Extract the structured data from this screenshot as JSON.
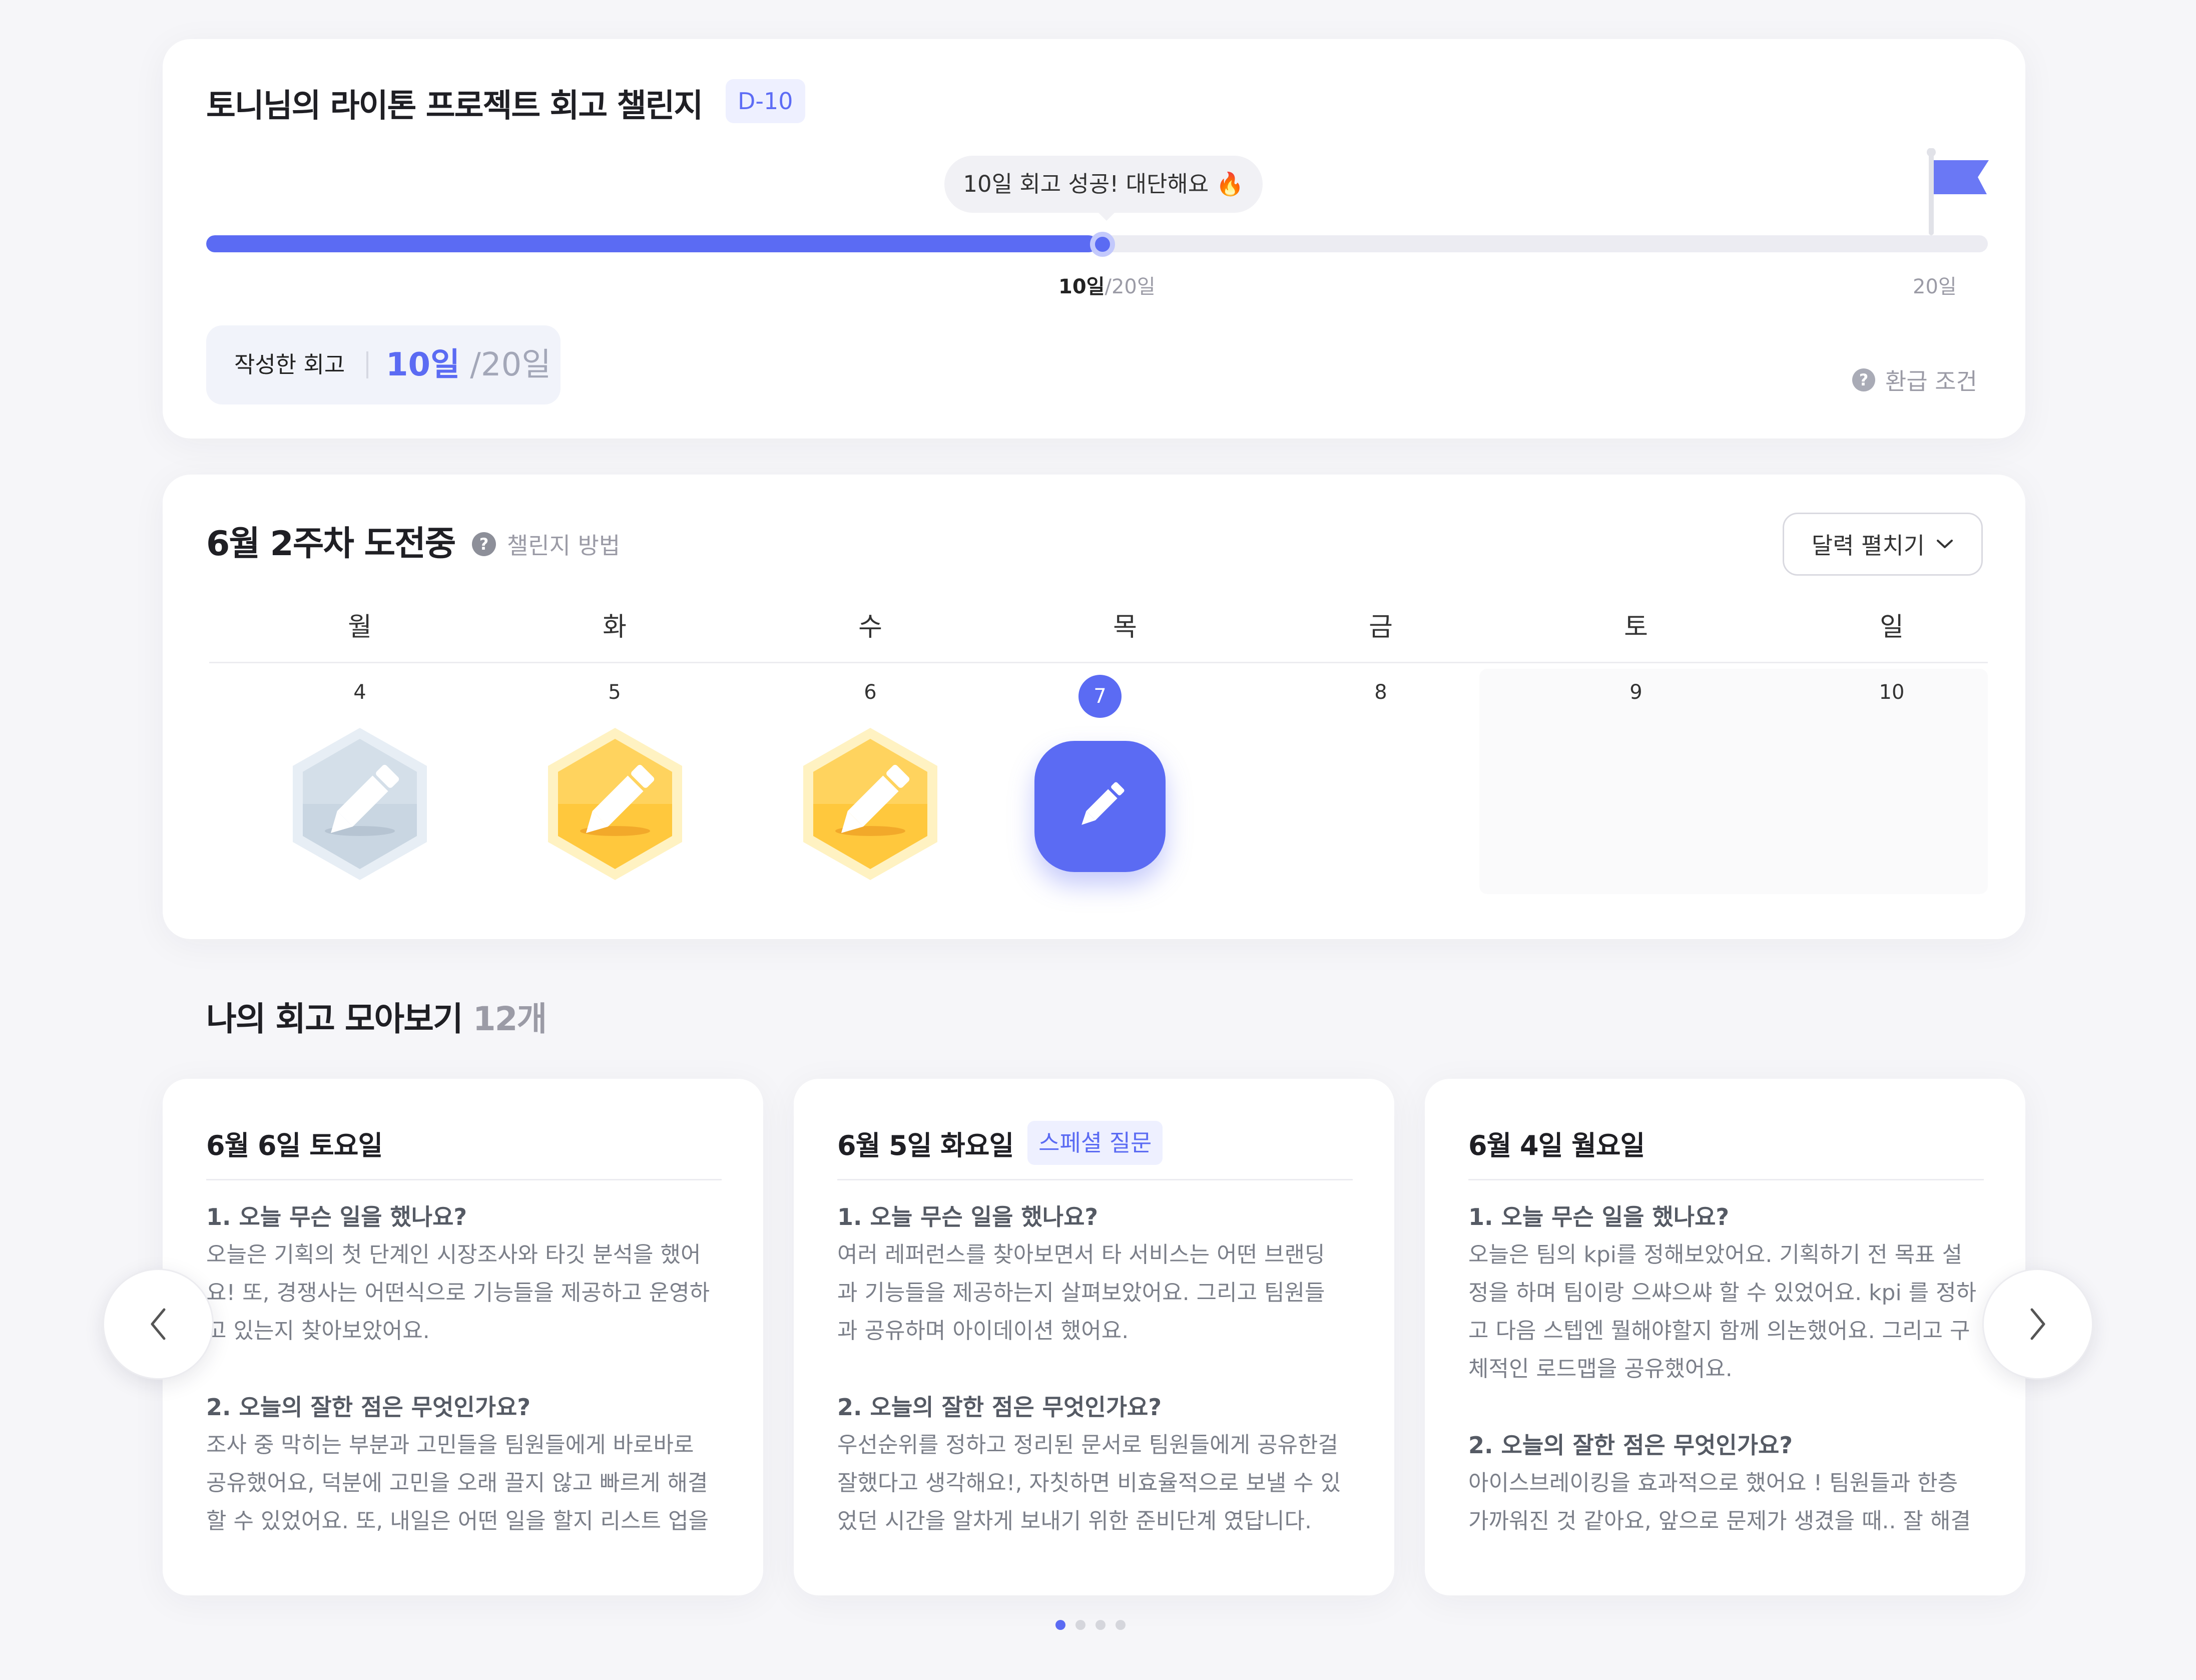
{
  "challenge": {
    "title": "토니님의 라이톤 프로젝트 회고 챌린지",
    "dday": "D-10",
    "bubble": "10일 회고 성공! 대단해요 🔥",
    "progress_fraction": 0.5,
    "progress_current": "10일",
    "progress_total": "/20일",
    "progress_end": "20일",
    "written_label": "작성한 회고",
    "written_current": "10일",
    "written_total": " /20일",
    "refund_label": "환급 조건",
    "accent_color": "#5b6bf3"
  },
  "week": {
    "title": "6월 2주차 도전중",
    "howto_label": "챌린지 방법",
    "calendar_button": "달력 펼치기",
    "days": [
      {
        "weekday": "월",
        "date": "4",
        "status": "silver"
      },
      {
        "weekday": "화",
        "date": "5",
        "status": "gold"
      },
      {
        "weekday": "수",
        "date": "6",
        "status": "gold"
      },
      {
        "weekday": "목",
        "date": "7",
        "status": "today"
      },
      {
        "weekday": "금",
        "date": "8",
        "status": "none"
      },
      {
        "weekday": "토",
        "date": "9",
        "status": "weekend"
      },
      {
        "weekday": "일",
        "date": "10",
        "status": "weekend"
      }
    ]
  },
  "retros": {
    "title": "나의 회고 모아보기",
    "count": "12개",
    "cards": [
      {
        "date": "6월 6일 토요일",
        "badge": "",
        "q1": "1. 오늘 무슨 일을 했나요?",
        "a1": [
          "오늘은 기획의 첫 단계인 시장조사와 타깃 분석을 했어",
          "요! 또, 경쟁사는 어떤식으로 기능들을 제공하고 운영하",
          "고 있는지 찾아보았어요."
        ],
        "q2": "2. 오늘의 잘한 점은 무엇인가요?",
        "a2": [
          "조사 중 막히는 부분과 고민들을 팀원들에게 바로바로",
          "공유했어요, 덕분에 고민을 오래 끌지 않고 빠르게 해결",
          "할 수 있었어요. 또, 내일은 어떤 일을 할지 리스트 업을"
        ]
      },
      {
        "date": "6월 5일 화요일",
        "badge": "스페셜 질문",
        "q1": "1. 오늘 무슨 일을 했나요?",
        "a1": [
          "여러 레퍼런스를 찾아보면서 타 서비스는 어떤 브랜딩",
          "과 기능들을 제공하는지 살펴보았어요. 그리고 팀원들",
          "과 공유하며 아이데이션 했어요."
        ],
        "q2": "2. 오늘의 잘한 점은 무엇인가요?",
        "a2": [
          "우선순위를 정하고 정리된 문서로 팀원들에게 공유한걸",
          "잘했다고 생각해요!, 자칫하면 비효율적으로 보낼 수 있",
          "었던 시간을 알차게 보내기 위한 준비단계 였답니다."
        ]
      },
      {
        "date": "6월 4일 월요일",
        "badge": "",
        "q1": "1. 오늘 무슨 일을 했나요?",
        "a1": [
          "오늘은 팀의 kpi를 정해보았어요. 기획하기 전 목표 설",
          "정을 하며 팀이랑 으쌰으쌰 할 수 있었어요. kpi 를 정하",
          "고 다음 스텝엔 뭘해야할지 함께 의논했어요. 그리고 구",
          "체적인 로드맵을 공유했어요."
        ],
        "q2": "2. 오늘의 잘한 점은 무엇인가요?",
        "a2": [
          "아이스브레이킹을 효과적으로 했어요 ! 팀원들과 한층",
          "가까워진 것 같아요, 앞으로 문제가 생겼을 때.. 잘 해결"
        ]
      }
    ],
    "page_dots": 4,
    "active_page": 1
  }
}
